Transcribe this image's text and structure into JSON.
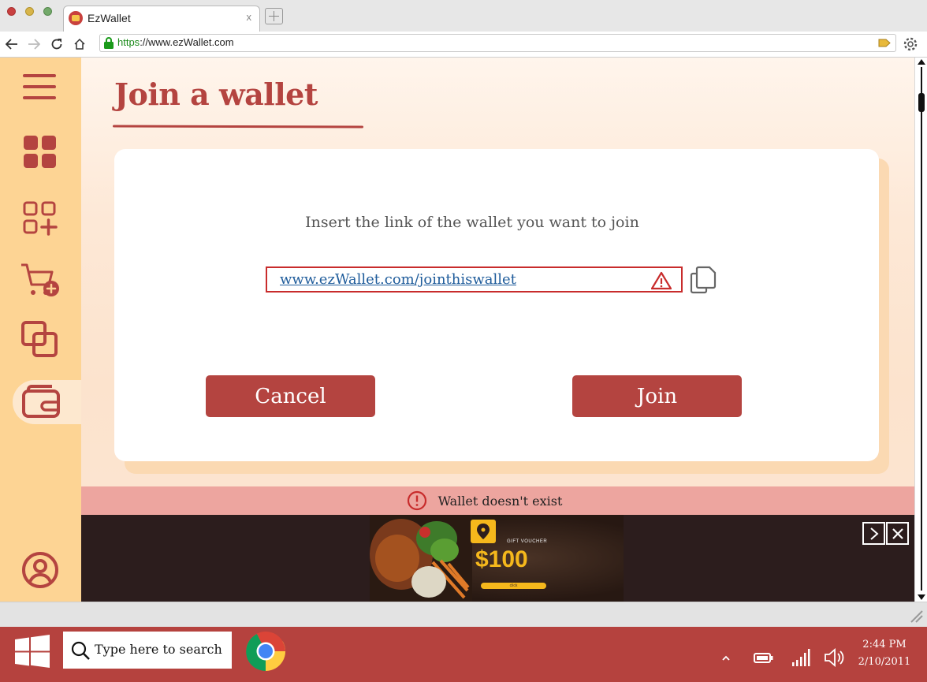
{
  "browser": {
    "tab_title": "EzWallet",
    "tab_close": "x",
    "url_scheme": "https",
    "url_rest": "://www.ezWallet.com"
  },
  "sidebar": {
    "items": [
      {
        "name": "menu",
        "icon": "hamburger-icon"
      },
      {
        "name": "dashboard",
        "icon": "grid-icon"
      },
      {
        "name": "add-group",
        "icon": "grid-plus-icon"
      },
      {
        "name": "add-expense",
        "icon": "cart-plus-icon"
      },
      {
        "name": "groups",
        "icon": "layers-icon"
      },
      {
        "name": "wallets",
        "icon": "wallet-icon",
        "active": true
      },
      {
        "name": "profile",
        "icon": "user-icon"
      }
    ]
  },
  "page": {
    "title": "Join a wallet",
    "prompt": "Insert the link of the wallet you want to join",
    "link_value": "www.ezWallet.com/jointhiswallet",
    "cancel_label": "Cancel",
    "join_label": "Join",
    "error_message": "Wallet doesn't exist"
  },
  "ad": {
    "voucher_label": "GIFT VOUCHER",
    "amount": "$100",
    "cta": "click"
  },
  "taskbar": {
    "search_placeholder": "Type here to search",
    "time": "2:44 PM",
    "date": "2/10/2011"
  },
  "colors": {
    "brand": "#b44440",
    "sidebar": "#fdd494",
    "error_bg": "#eda59f",
    "error_border": "#c82c2c",
    "link": "#1f5c9b",
    "voucher": "#f5b81c"
  }
}
